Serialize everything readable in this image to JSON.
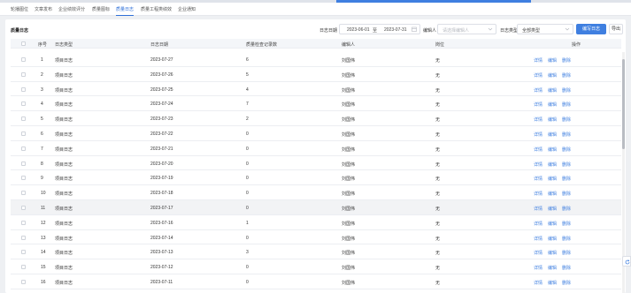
{
  "tabs": [
    {
      "label": "轮播图位",
      "active": false
    },
    {
      "label": "文章发布",
      "active": false
    },
    {
      "label": "企业绩效评分",
      "active": false
    },
    {
      "label": "质量图标",
      "active": false
    },
    {
      "label": "质量日志",
      "active": true
    },
    {
      "label": "质量工程类绩效",
      "active": false
    },
    {
      "label": "企业通知",
      "active": false
    }
  ],
  "panel": {
    "title": "质量日志"
  },
  "filters": {
    "date_label": "日志日期",
    "date_start": "2023-06-01",
    "date_sep": "至",
    "date_end": "2023-07-31",
    "editor_label": "编辑人",
    "editor_placeholder": "请选择编辑人",
    "type_label": "日志类型",
    "type_value": "全部类型"
  },
  "buttons": {
    "write": "编写日志",
    "export": "导出"
  },
  "columns": {
    "index": "序号",
    "type": "日志类型",
    "date": "日志日期",
    "count": "质量检查记录数",
    "editor": "编辑人",
    "post": "岗位",
    "ops": "操作"
  },
  "ops": {
    "detail": "详情",
    "edit": "编辑",
    "delete": "删除"
  },
  "rows": [
    {
      "index": "1",
      "type": "项目日志",
      "date": "2023-07-27",
      "count": "6",
      "editor": "刘国伟",
      "post": "无"
    },
    {
      "index": "2",
      "type": "项目日志",
      "date": "2023-07-26",
      "count": "5",
      "editor": "刘国伟",
      "post": "无"
    },
    {
      "index": "3",
      "type": "项目日志",
      "date": "2023-07-25",
      "count": "4",
      "editor": "刘国伟",
      "post": "无"
    },
    {
      "index": "4",
      "type": "项目日志",
      "date": "2023-07-24",
      "count": "7",
      "editor": "刘国伟",
      "post": "无"
    },
    {
      "index": "5",
      "type": "项目日志",
      "date": "2023-07-23",
      "count": "2",
      "editor": "刘国伟",
      "post": "无"
    },
    {
      "index": "6",
      "type": "项目日志",
      "date": "2023-07-22",
      "count": "0",
      "editor": "刘国伟",
      "post": "无"
    },
    {
      "index": "7",
      "type": "项目日志",
      "date": "2023-07-21",
      "count": "0",
      "editor": "刘国伟",
      "post": "无"
    },
    {
      "index": "8",
      "type": "项目日志",
      "date": "2023-07-20",
      "count": "0",
      "editor": "刘国伟",
      "post": "无"
    },
    {
      "index": "9",
      "type": "项目日志",
      "date": "2023-07-19",
      "count": "0",
      "editor": "刘国伟",
      "post": "无"
    },
    {
      "index": "10",
      "type": "项目日志",
      "date": "2023-07-18",
      "count": "0",
      "editor": "刘国伟",
      "post": "无"
    },
    {
      "index": "11",
      "type": "项目日志",
      "date": "2023-07-17",
      "count": "0",
      "editor": "刘国伟",
      "post": "无"
    },
    {
      "index": "12",
      "type": "项目日志",
      "date": "2023-07-16",
      "count": "1",
      "editor": "刘国伟",
      "post": "无"
    },
    {
      "index": "13",
      "type": "项目日志",
      "date": "2023-07-14",
      "count": "0",
      "editor": "刘国伟",
      "post": "无"
    },
    {
      "index": "14",
      "type": "项目日志",
      "date": "2023-07-13",
      "count": "3",
      "editor": "刘国伟",
      "post": "无"
    },
    {
      "index": "15",
      "type": "项目日志",
      "date": "2023-07-12",
      "count": "0",
      "editor": "刘国伟",
      "post": "无"
    },
    {
      "index": "16",
      "type": "项目日志",
      "date": "2023-07-11",
      "count": "0",
      "editor": "刘国伟",
      "post": "无"
    }
  ],
  "colors": {
    "accent": "#3f7fe0",
    "row_hover": "#f2f3f5"
  },
  "icons": {
    "date": "calendar-icon",
    "editor": "chevron-down-icon",
    "type": "chevron-down-icon",
    "side": "refresh-icon"
  }
}
